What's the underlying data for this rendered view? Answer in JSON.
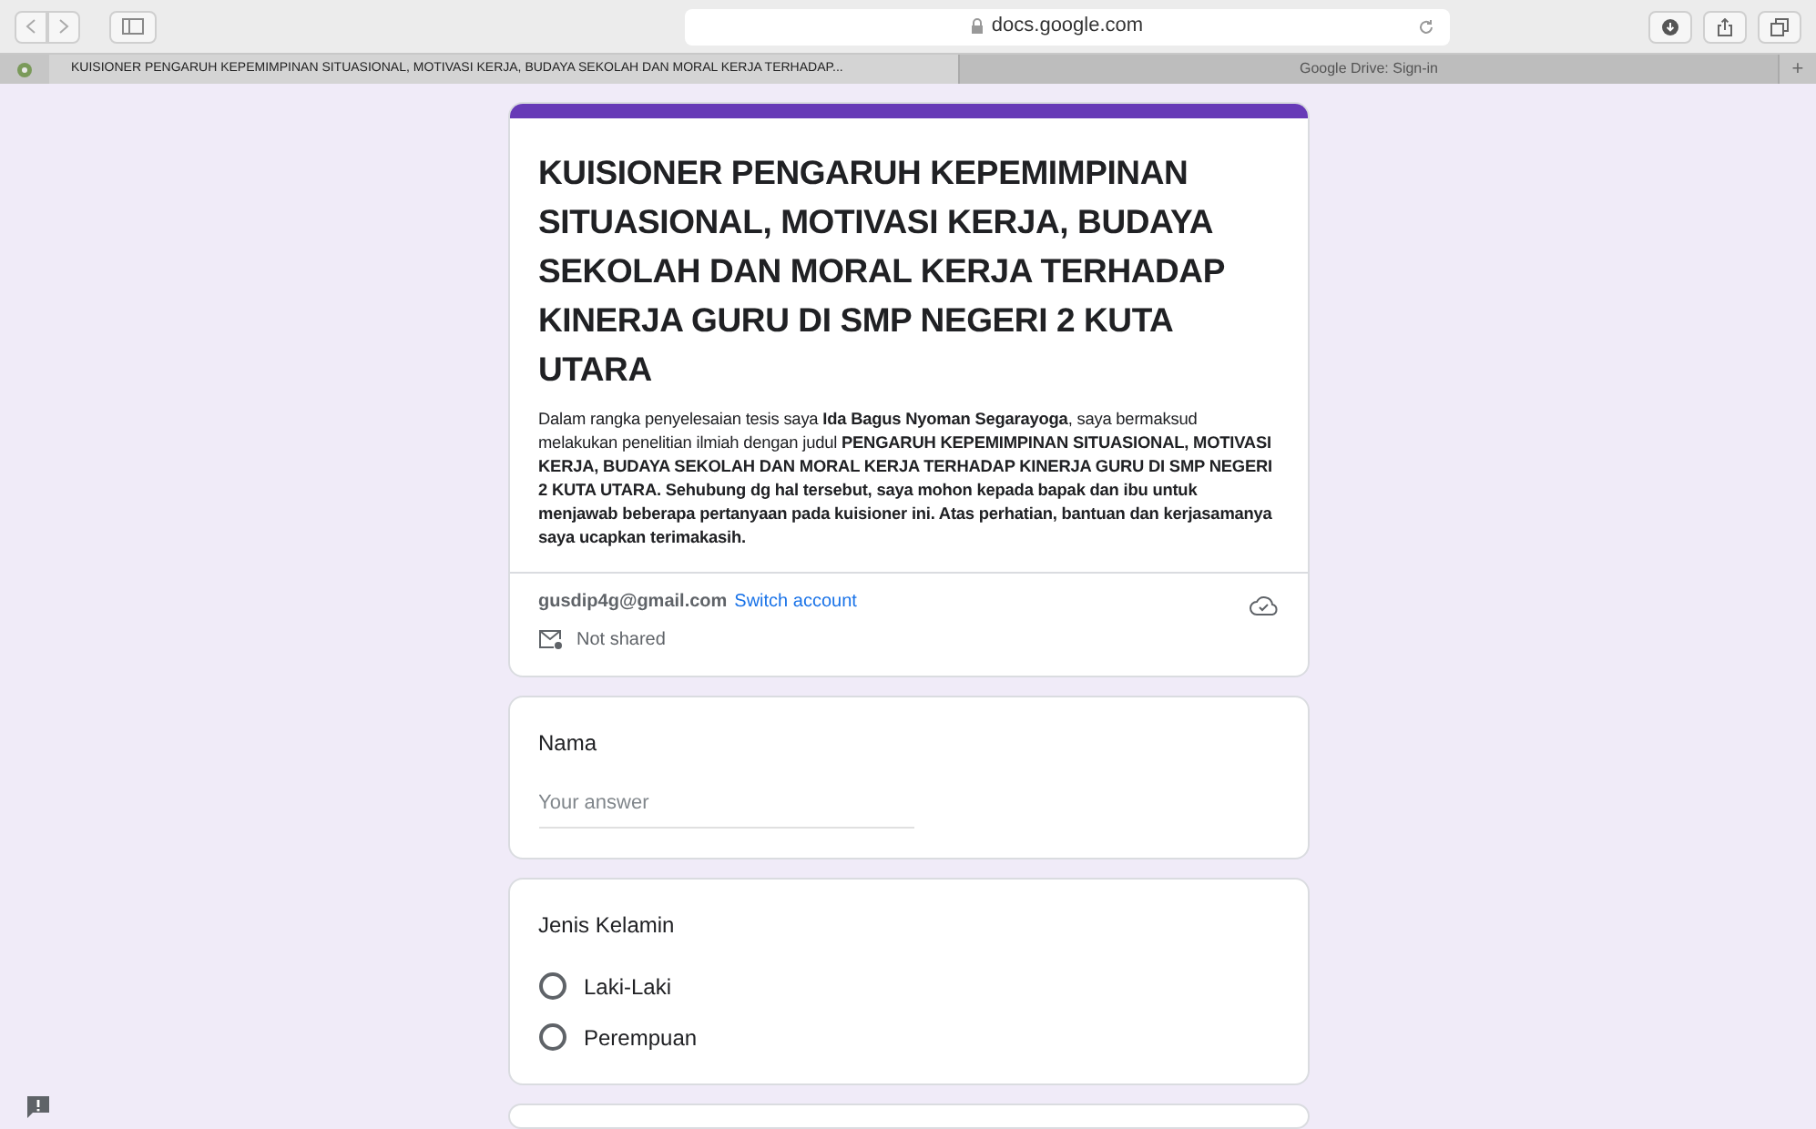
{
  "browser": {
    "address": "docs.google.com",
    "tabs": [
      {
        "label": "KUISIONER PENGARUH KEPEMIMPINAN SITUASIONAL, MOTIVASI KERJA, BUDAYA SEKOLAH DAN MORAL KERJA TERHADAP...",
        "selected": true
      },
      {
        "label": "Google Drive: Sign-in",
        "selected": false
      }
    ],
    "new_tab": "+"
  },
  "form": {
    "title": "KUISIONER PENGARUH KEPEMIMPINAN SITUASIONAL, MOTIVASI KERJA, BUDAYA SEKOLAH DAN MORAL KERJA TERHADAP KINERJA GURU DI SMP NEGERI 2 KUTA UTARA",
    "description": "Dalam rangka penyelesaian tesis saya **Ida Bagus Nyoman Segarayoga**, saya bermaksud melakukan penelitian ilmiah dengan judul **PENGARUH KEPEMIMPINAN SITUASIONAL, MOTIVASI KERJA, BUDAYA SEKOLAH DAN MORAL KERJA TERHADAP KINERJA GURU DI SMP NEGERI 2 KUTA UTARA. Sehubung dg hal tersebut, saya mohon kepada bapak dan ibu untuk menjawab beberapa pertanyaan pada kuisioner ini. Atas perhatian, bantuan dan kerjasamanya saya ucapkan terimakasih.**",
    "email": "gusdip4g@gmail.com",
    "switch_account": "Switch account",
    "sharing": "Not shared"
  },
  "questions": [
    {
      "kind": "text",
      "label": "Nama",
      "placeholder": "Your answer"
    },
    {
      "kind": "radio",
      "label": "Jenis Kelamin",
      "options": [
        {
          "label": "Laki-Laki",
          "selected": false
        },
        {
          "label": "Perempuan",
          "selected": false
        }
      ]
    }
  ]
}
